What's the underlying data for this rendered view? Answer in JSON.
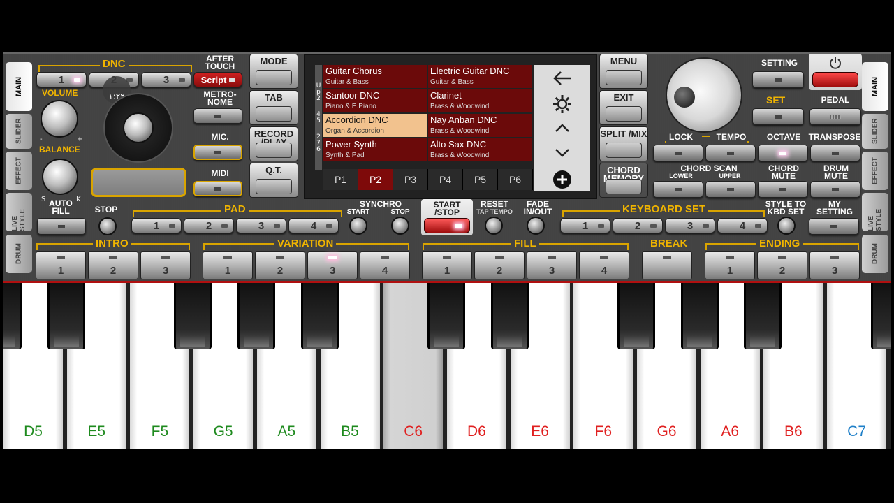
{
  "tabs_left": [
    "MAIN",
    "SLIDER",
    "EFFECT",
    "LIVE STYLE",
    "DRUM"
  ],
  "tabs_right": [
    "MAIN",
    "SLIDER",
    "EFFECT",
    "LIVE STYLE",
    "DRUM"
  ],
  "dnc": {
    "title": "DNC",
    "buttons": [
      "1",
      "2",
      "3"
    ],
    "after_touch": "AFTER TOUCH",
    "script_label": "Script",
    "overlay_time": "١:٢٢"
  },
  "left": {
    "volume": "VOLUME",
    "balance": "BALANCE",
    "minus": "-",
    "plus": "+",
    "s": "S",
    "k": "K",
    "metronome": "METRO-NOME",
    "mic": "MIC.",
    "midi": "MIDI"
  },
  "mid_buttons": {
    "mode": "MODE",
    "tab": "TAB",
    "record_play": "RECORD /PLAY",
    "qt": "Q.T."
  },
  "screen": {
    "side_letters": [
      "U",
      "p",
      "2",
      "4",
      "5",
      "2",
      "7",
      "6"
    ],
    "slots": [
      {
        "name": "Guitar Chorus",
        "category": "Guitar & Bass"
      },
      {
        "name": "Electric Guitar DNC",
        "category": "Guitar & Bass"
      },
      {
        "name": "Santoor DNC",
        "category": "Piano & E.Piano"
      },
      {
        "name": "Clarinet",
        "category": "Brass & Woodwind"
      },
      {
        "name": "Accordion DNC",
        "category": "Organ & Accordion"
      },
      {
        "name": "Nay Anban DNC",
        "category": "Brass & Woodwind"
      },
      {
        "name": "Power Synth",
        "category": "Synth & Pad"
      },
      {
        "name": "Alto Sax DNC",
        "category": "Brass & Woodwind"
      }
    ],
    "pages": [
      "P1",
      "P2",
      "P3",
      "P4",
      "P5",
      "P6"
    ],
    "selected_page": "P2",
    "selected_slot": "Accordion DNC"
  },
  "right_mid": {
    "menu": "MENU",
    "exit": "EXIT",
    "split_mix": "SPLIT /MIX",
    "chord_memory": "CHORD MEMORY"
  },
  "right": {
    "setting": "SETTING",
    "set": "SET",
    "pedal": "PEDAL",
    "lock": "LOCK",
    "tempo": "TEMPO",
    "octave": "OCTAVE",
    "transpose": "TRANSPOSE",
    "chord_scan": "CHORD SCAN",
    "lower": "LOWER",
    "upper": "UPPER",
    "chord_mute": "CHORD MUTE",
    "drum_mute": "DRUM MUTE"
  },
  "row3": {
    "auto_fill": "AUTO FILL",
    "stop": "STOP",
    "pad": "PAD",
    "pad_buttons": [
      "1",
      "2",
      "3",
      "4"
    ],
    "synchro": "SYNCHRO",
    "synchro_start": "START",
    "synchro_stop": "STOP",
    "start_stop": "START /STOP",
    "reset": "RESET",
    "tap_tempo": "TAP TEMPO",
    "fade": "FADE IN/OUT",
    "keyboard_set": "KEYBOARD SET",
    "kbd_buttons": [
      "1",
      "2",
      "3",
      "4"
    ],
    "style_to_kbd": "STYLE TO KBD SET",
    "my_setting": "MY SETTING"
  },
  "row4": {
    "intro": "INTRO",
    "intro_buttons": [
      "1",
      "2",
      "3"
    ],
    "variation": "VARIATION",
    "variation_buttons": [
      "1",
      "2",
      "3",
      "4"
    ],
    "fill": "FILL",
    "fill_buttons": [
      "1",
      "2",
      "3",
      "4"
    ],
    "break": "BREAK",
    "ending": "ENDING",
    "ending_buttons": [
      "1",
      "2",
      "3"
    ]
  },
  "keys": [
    {
      "label": "D5",
      "color": "#1e8a1e"
    },
    {
      "label": "E5",
      "color": "#1e8a1e"
    },
    {
      "label": "F5",
      "color": "#1e8a1e"
    },
    {
      "label": "G5",
      "color": "#1e8a1e"
    },
    {
      "label": "A5",
      "color": "#1e8a1e"
    },
    {
      "label": "B5",
      "color": "#1e8a1e"
    },
    {
      "label": "C6",
      "color": "#e02020"
    },
    {
      "label": "D6",
      "color": "#e02020"
    },
    {
      "label": "E6",
      "color": "#e02020"
    },
    {
      "label": "F6",
      "color": "#e02020"
    },
    {
      "label": "G6",
      "color": "#e02020"
    },
    {
      "label": "A6",
      "color": "#e02020"
    },
    {
      "label": "B6",
      "color": "#e02020"
    },
    {
      "label": "C7",
      "color": "#1e7fc8"
    }
  ],
  "colors": {
    "accent_gold": "#f0b400",
    "slot_red": "#6b0a0a",
    "slot_selected": "#f2c28e",
    "power_red": "#c01818"
  }
}
